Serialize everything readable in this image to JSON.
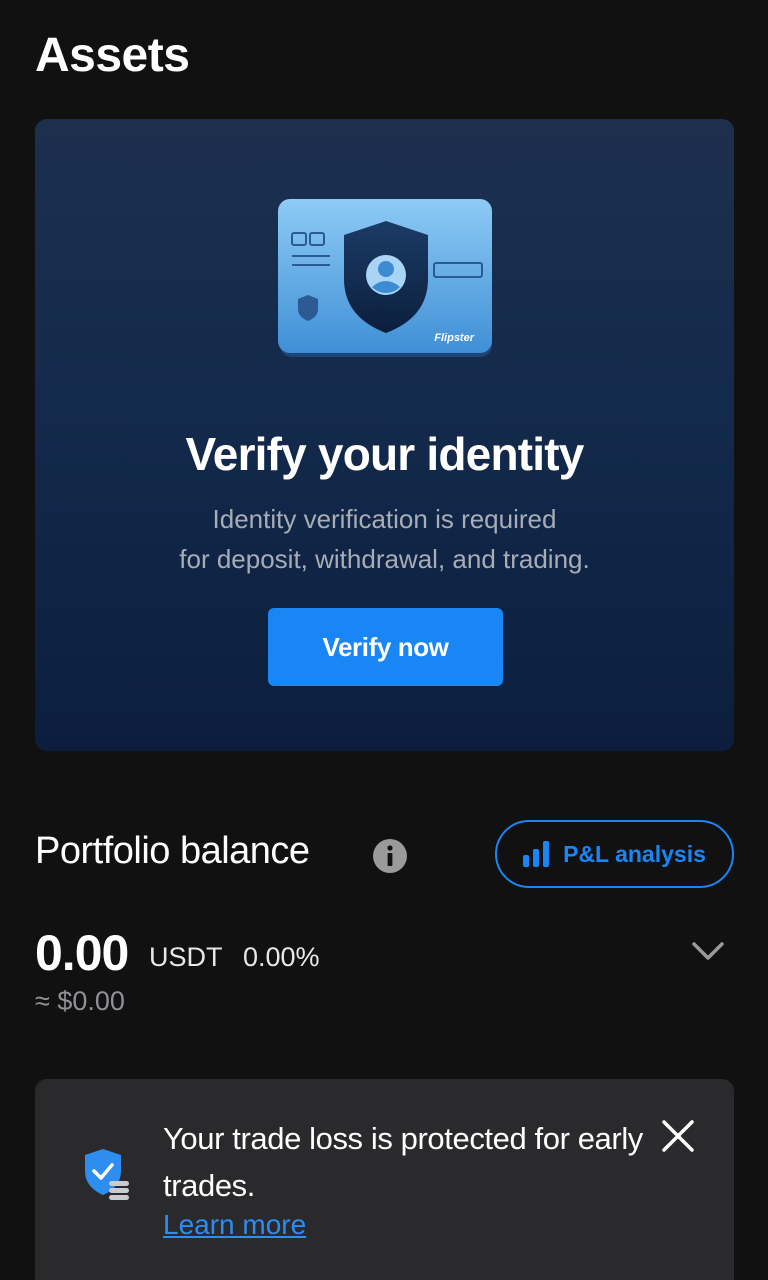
{
  "page": {
    "title": "Assets"
  },
  "verify": {
    "card_brand": "Flipster",
    "title": "Verify your identity",
    "desc_line1": "Identity verification is required",
    "desc_line2": "for deposit, withdrawal, and trading.",
    "button_label": "Verify now"
  },
  "portfolio": {
    "title": "Portfolio balance",
    "pl_button_label": "P&L analysis",
    "balance": "0.00",
    "currency": "USDT",
    "change": "0.00%",
    "usd_value": "≈ $0.00"
  },
  "protection": {
    "text": "Your trade loss is protected for early trades.",
    "link_label": "Learn more"
  },
  "colors": {
    "accent": "#1a86f5",
    "background": "#111111",
    "banner_bg": "#2a2a2c"
  },
  "icons": [
    "info-icon",
    "bar-chart-icon",
    "chevron-down-icon",
    "shield-check-icon",
    "close-icon",
    "id-card-icon"
  ]
}
